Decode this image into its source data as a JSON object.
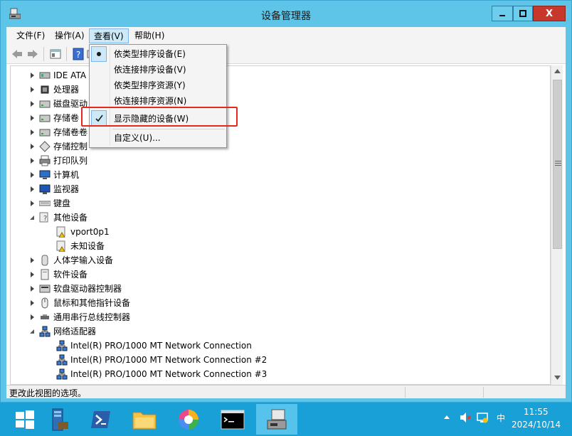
{
  "window": {
    "title": "设备管理器",
    "close_symbol": "X"
  },
  "menubar": {
    "file": "文件(F)",
    "action": "操作(A)",
    "view": "查看(V)",
    "help": "帮助(H)"
  },
  "view_menu": {
    "items": [
      "依类型排序设备(E)",
      "依连接排序设备(V)",
      "依类型排序资源(Y)",
      "依连接排序资源(N)",
      "显示隐藏的设备(W)",
      "自定义(U)..."
    ],
    "selected_radio": "依类型排序设备(E)",
    "checked_item": "显示隐藏的设备(W)"
  },
  "tree": {
    "items": [
      "IDE ATA",
      "处理器",
      "磁盘驱动",
      "存储卷",
      "存储卷卷",
      "存储控制",
      "打印队列",
      "计算机",
      "监视器",
      "键盘",
      "其他设备",
      "vport0p1",
      "未知设备",
      "人体学输入设备",
      "软件设备",
      "软盘驱动器控制器",
      "鼠标和其他指针设备",
      "通用串行总线控制器",
      "网络适配器",
      "Intel(R) PRO/1000 MT Network Connection",
      "Intel(R) PRO/1000 MT Network Connection #2",
      "Intel(R) PRO/1000 MT Network Connection #3"
    ]
  },
  "status": {
    "text": "更改此视图的选项。"
  },
  "taskbar": {
    "ime": "中",
    "time": "11:55",
    "date": "2024/10/14"
  },
  "colors": {
    "title_bar": "#5fc5e8",
    "close_button": "#c7382b",
    "taskbar": "#19a0d6",
    "highlight": "#cde8f6",
    "annotation": "#e5291e"
  }
}
